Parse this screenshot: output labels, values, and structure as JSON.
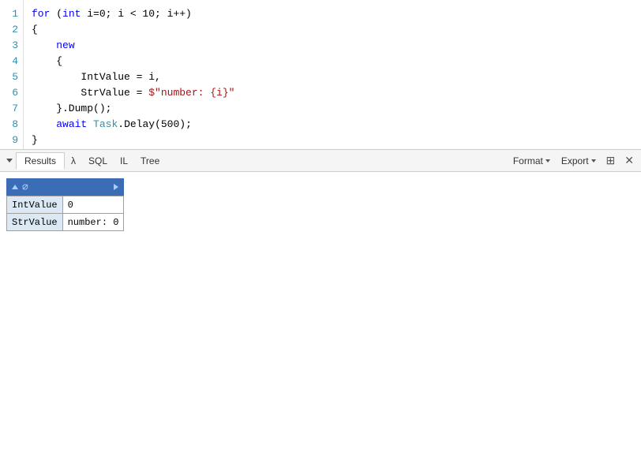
{
  "editor": {
    "lines": [
      {
        "num": 1,
        "tokens": [
          {
            "text": "for",
            "cls": "kw"
          },
          {
            "text": " (",
            "cls": "punct"
          },
          {
            "text": "int",
            "cls": "kw"
          },
          {
            "text": " i=0; i < 10; i++)",
            "cls": "var"
          }
        ]
      },
      {
        "num": 2,
        "tokens": [
          {
            "text": "{",
            "cls": "punct"
          }
        ]
      },
      {
        "num": 3,
        "tokens": [
          {
            "text": "    new",
            "cls": "kw"
          }
        ]
      },
      {
        "num": 4,
        "tokens": [
          {
            "text": "    {",
            "cls": "punct"
          }
        ]
      },
      {
        "num": 5,
        "tokens": [
          {
            "text": "        IntValue = i,",
            "cls": "var"
          }
        ]
      },
      {
        "num": 6,
        "tokens": [
          {
            "text": "        StrValue = ",
            "cls": "var"
          },
          {
            "text": "$\"number: {i}\"",
            "cls": "str"
          }
        ]
      },
      {
        "num": 7,
        "tokens": [
          {
            "text": "    }.Dump();",
            "cls": "var"
          }
        ]
      },
      {
        "num": 8,
        "tokens": [
          {
            "text": "    ",
            "cls": "var"
          },
          {
            "text": "await",
            "cls": "kw"
          },
          {
            "text": " ",
            "cls": "var"
          },
          {
            "text": "Task",
            "cls": "type"
          },
          {
            "text": ".Delay(500);",
            "cls": "var"
          }
        ]
      },
      {
        "num": 9,
        "tokens": [
          {
            "text": "}",
            "cls": "punct"
          }
        ]
      }
    ]
  },
  "toolbar": {
    "dropdown_label": "",
    "tabs": [
      {
        "label": "Results",
        "active": true
      },
      {
        "label": "λ",
        "active": false
      },
      {
        "label": "SQL",
        "active": false
      },
      {
        "label": "IL",
        "active": false
      },
      {
        "label": "Tree",
        "active": false
      }
    ],
    "format_label": "Format",
    "export_label": "Export",
    "icon_grid": "⊞",
    "icon_close": "✕"
  },
  "results": {
    "nav": {
      "up_label": "▲",
      "right_label": "▶",
      "null_label": "∅"
    },
    "table": {
      "rows": [
        {
          "key": "IntValue",
          "value": "0"
        },
        {
          "key": "StrValue",
          "value": "number: 0"
        }
      ]
    }
  }
}
